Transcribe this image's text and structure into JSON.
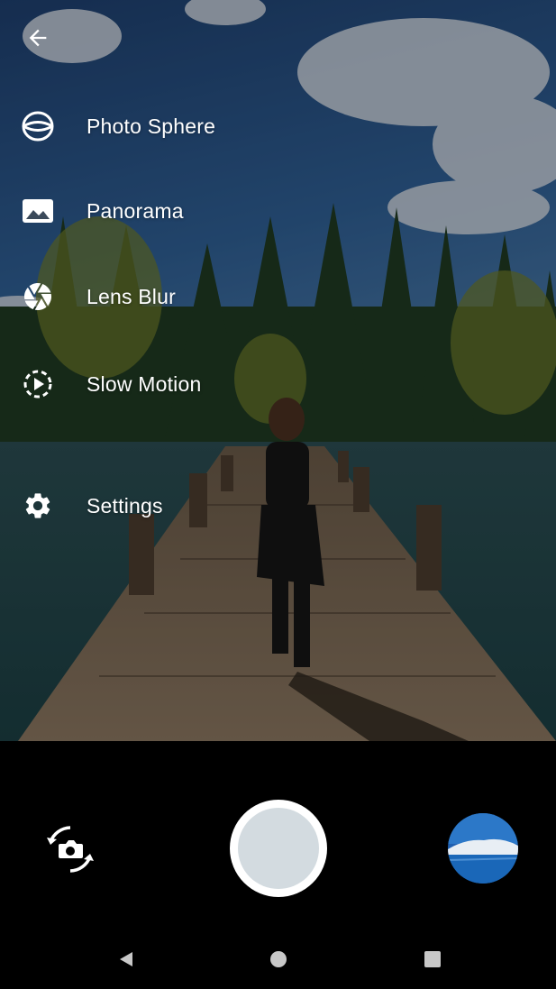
{
  "menu": {
    "items": [
      {
        "id": "photo-sphere",
        "label": "Photo Sphere",
        "icon": "photo-sphere-icon"
      },
      {
        "id": "panorama",
        "label": "Panorama",
        "icon": "panorama-icon"
      },
      {
        "id": "lens-blur",
        "label": "Lens Blur",
        "icon": "lens-blur-icon"
      },
      {
        "id": "slow-motion",
        "label": "Slow Motion",
        "icon": "slow-motion-icon"
      },
      {
        "id": "settings",
        "label": "Settings",
        "icon": "gear-icon"
      }
    ]
  },
  "controls": {
    "switch_camera_icon": "switch-camera-icon",
    "shutter_color": "#d3dbe0"
  },
  "navbar": {
    "back_icon": "nav-back-icon",
    "home_icon": "nav-home-icon",
    "recents_icon": "nav-recents-icon"
  }
}
